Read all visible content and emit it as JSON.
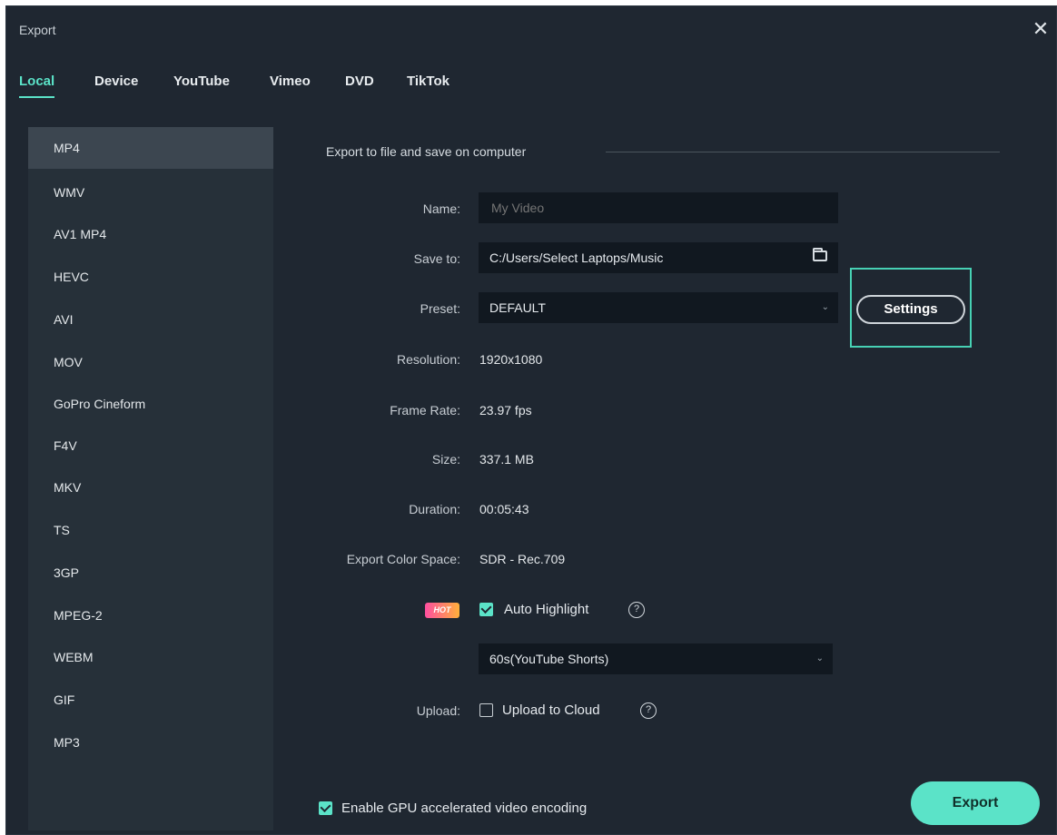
{
  "window": {
    "title": "Export",
    "close_icon": "close-icon"
  },
  "tabs": [
    {
      "label": "Local",
      "active": true
    },
    {
      "label": "Device"
    },
    {
      "label": "YouTube"
    },
    {
      "label": "Vimeo"
    },
    {
      "label": "DVD"
    },
    {
      "label": "TikTok"
    }
  ],
  "formats": [
    {
      "label": "MP4",
      "active": true
    },
    {
      "label": "WMV"
    },
    {
      "label": "AV1 MP4"
    },
    {
      "label": "HEVC"
    },
    {
      "label": "AVI"
    },
    {
      "label": "MOV"
    },
    {
      "label": "GoPro Cineform"
    },
    {
      "label": "F4V"
    },
    {
      "label": "MKV"
    },
    {
      "label": "TS"
    },
    {
      "label": "3GP"
    },
    {
      "label": "MPEG-2"
    },
    {
      "label": "WEBM"
    },
    {
      "label": "GIF"
    },
    {
      "label": "MP3"
    }
  ],
  "section_title": "Export to file and save on computer",
  "fields": {
    "name": {
      "label": "Name:",
      "placeholder": "My Video"
    },
    "save_to": {
      "label": "Save to:",
      "value": "C:/Users/Select Laptops/Music"
    },
    "preset": {
      "label": "Preset:",
      "value": "DEFAULT"
    },
    "resolution": {
      "label": "Resolution:",
      "value": "1920x1080"
    },
    "frame_rate": {
      "label": "Frame Rate:",
      "value": "23.97 fps"
    },
    "size": {
      "label": "Size:",
      "value": "337.1 MB"
    },
    "duration": {
      "label": "Duration:",
      "value": "00:05:43"
    },
    "color_space": {
      "label": "Export Color Space:",
      "value": "SDR - Rec.709"
    }
  },
  "settings_button": "Settings",
  "hot_badge": "HOT",
  "auto_highlight": {
    "label": "Auto Highlight",
    "checked": true
  },
  "auto_highlight_option": "60s(YouTube Shorts)",
  "upload": {
    "label": "Upload:",
    "checkbox_label": "Upload to Cloud",
    "checked": false
  },
  "gpu": {
    "label": "Enable GPU accelerated video encoding",
    "checked": true
  },
  "export_button": "Export",
  "colors": {
    "accent": "#5be3c8",
    "background": "#1f2731",
    "sidebar": "#263039",
    "highlight_frame": "#47d1b4"
  }
}
